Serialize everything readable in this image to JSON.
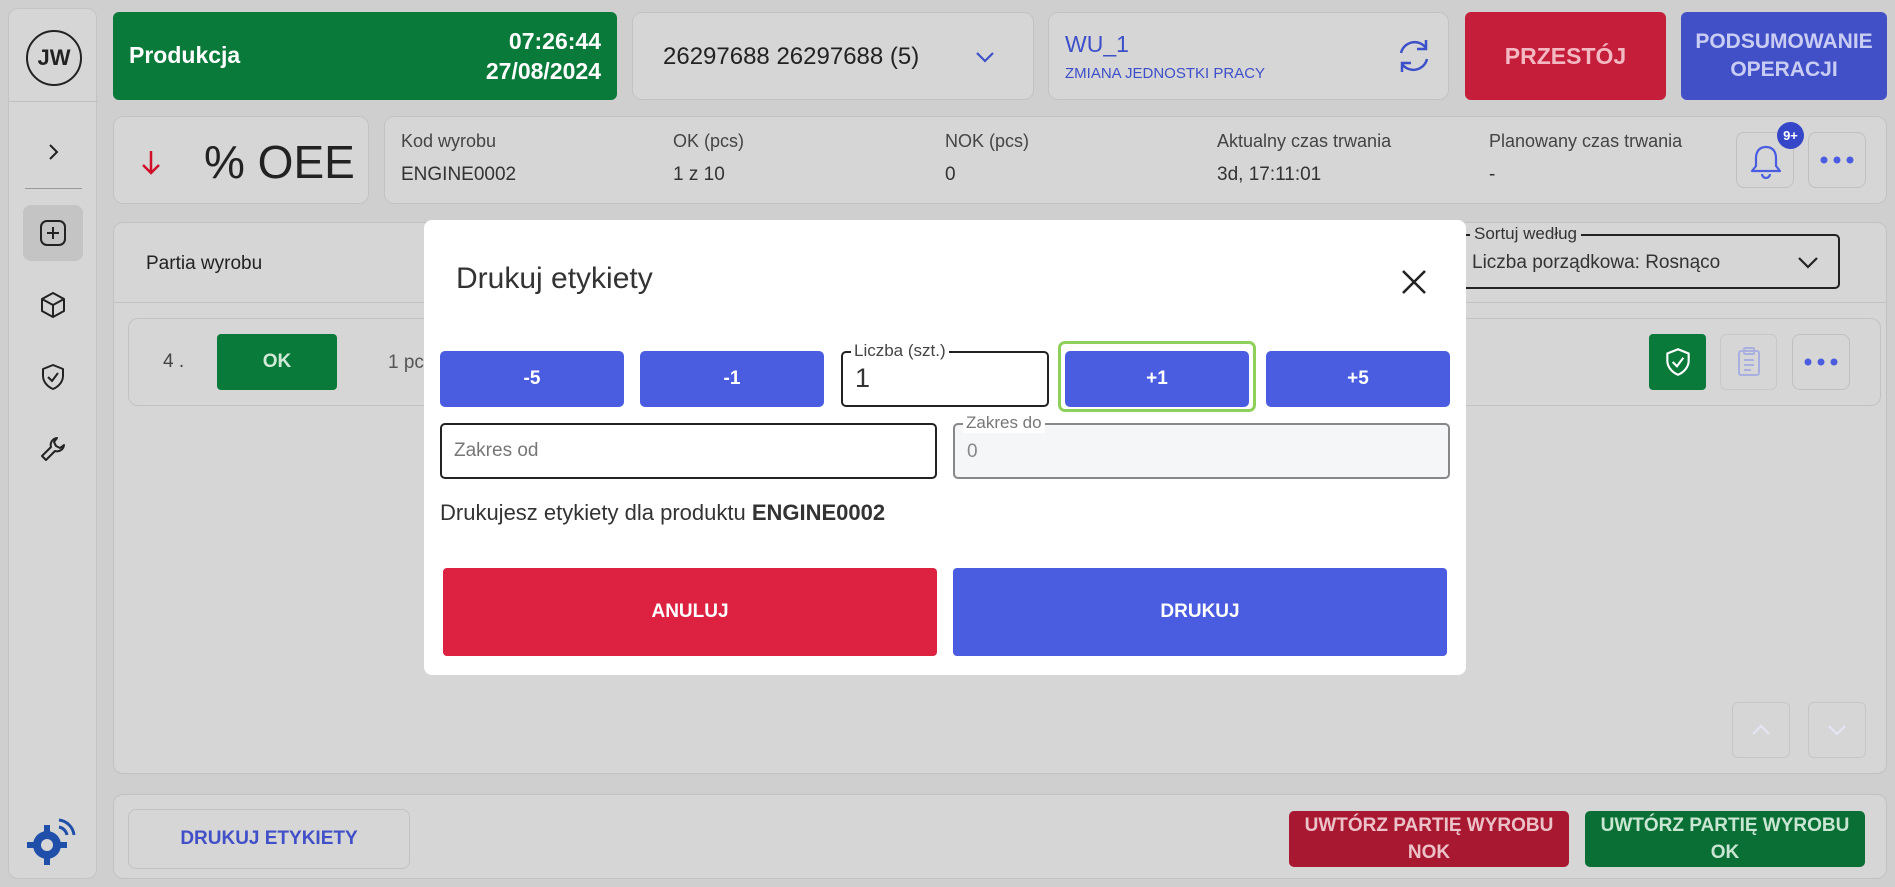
{
  "user": {
    "initials": "JW"
  },
  "header": {
    "status_label": "Produkcja",
    "time": "07:26:44",
    "date": "27/08/2024",
    "order_text": "26297688 26297688  (5)",
    "work_unit": "WU_1",
    "work_unit_change": "ZMIANA JEDNOSTKI PRACY",
    "downtime_button": "PRZESTÓJ",
    "summary_button_line1": "PODSUMOWANIE",
    "summary_button_line2": "OPERACJI"
  },
  "oee": {
    "label": "% OEE",
    "trend": "down",
    "trend_color": "#d0102a"
  },
  "info": [
    {
      "key": "Kod wyrobu",
      "value": "ENGINE0002"
    },
    {
      "key": "OK (pcs)",
      "value": "1 z 10"
    },
    {
      "key": "NOK (pcs)",
      "value": "0"
    },
    {
      "key": "Aktualny czas trwania",
      "value": "3d, 17:11:01"
    },
    {
      "key": "Planowany czas trwania",
      "value": "-"
    }
  ],
  "notifications": {
    "badge": "9+"
  },
  "content": {
    "header_label": "Partia wyrobu",
    "sort_legend": "Sortuj według",
    "sort_value": "Liczba porządkowa: Rosnąco",
    "row": {
      "number": "4 .",
      "status": "OK",
      "partial_text": "1 pc"
    }
  },
  "footer": {
    "print_labels": "DRUKUJ ETYKIETY",
    "create_nok_line1": "UWTÓRZ PARTIĘ WYROBU",
    "create_nok_line2": "NOK",
    "create_ok_line1": "UWTÓRZ PARTIĘ WYROBU",
    "create_ok_line2": "OK"
  },
  "modal": {
    "title": "Drukuj etykiety",
    "minus5": "-5",
    "minus1": "-1",
    "qty_legend": "Liczba (szt.)",
    "qty_value": "1",
    "plus1": "+1",
    "plus5": "+5",
    "from_placeholder": "Zakres od",
    "to_legend": "Zakres do",
    "to_value": "0",
    "message_prefix": "Drukujesz etykiety dla produktu ",
    "message_product": "ENGINE0002",
    "cancel": "ANULUJ",
    "print": "DRUKUJ"
  },
  "colors": {
    "production_green": "#0a7a3a",
    "downtime_red": "#c41e3a",
    "primary_blue": "#4a5ce0",
    "highlight_green": "#8fd05a"
  }
}
